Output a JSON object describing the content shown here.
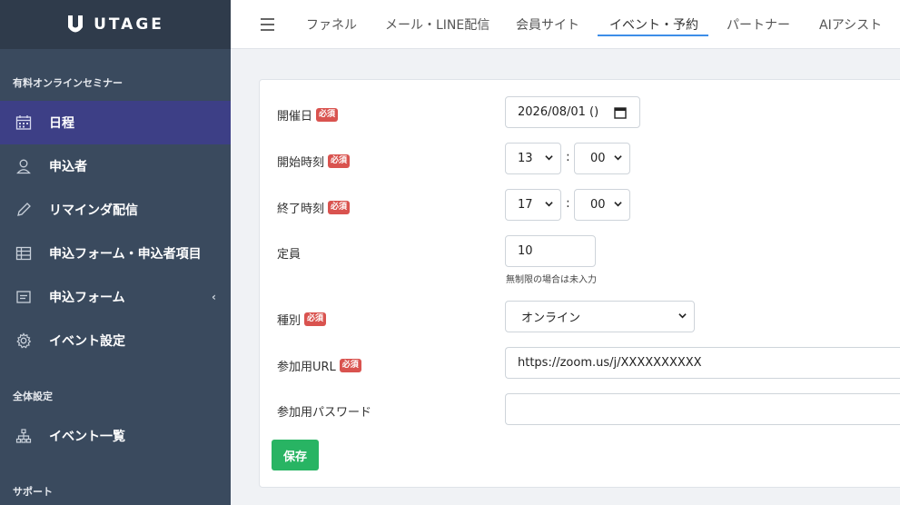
{
  "brand": {
    "name": "UTAGE"
  },
  "sidebar": {
    "section_seminar": "有料オンラインセミナー",
    "items": [
      {
        "label": "日程",
        "icon": "calendar-icon"
      },
      {
        "label": "申込者",
        "icon": "user-icon"
      },
      {
        "label": "リマインダ配信",
        "icon": "pencil-icon"
      },
      {
        "label": "申込フォーム・申込者項目",
        "icon": "table-icon"
      },
      {
        "label": "申込フォーム",
        "icon": "form-icon",
        "chevron": "‹"
      },
      {
        "label": "イベント設定",
        "icon": "gear-icon"
      }
    ],
    "section_global": "全体設定",
    "global_items": [
      {
        "label": "イベント一覧",
        "icon": "sitemap-icon"
      }
    ],
    "section_support": "サポート"
  },
  "topnav": {
    "tabs": [
      "ファネル",
      "メール・LINE配信",
      "会員サイト",
      "イベント・予約",
      "パートナー",
      "AIアシスト"
    ],
    "active_tab": "イベント・予約"
  },
  "form": {
    "required_badge": "必須",
    "date": {
      "label": "開催日",
      "value": "2026/08/01 ()"
    },
    "start_time": {
      "label": "開始時刻",
      "hour": "13",
      "minute": "00"
    },
    "end_time": {
      "label": "終了時刻",
      "hour": "17",
      "minute": "00"
    },
    "capacity": {
      "label": "定員",
      "value": "10",
      "hint": "無制限の場合は未入力"
    },
    "type": {
      "label": "種別",
      "value": "オンライン"
    },
    "url": {
      "label": "参加用URL",
      "value": "https://zoom.us/j/XXXXXXXXXX"
    },
    "password": {
      "label": "参加用パスワード",
      "value": ""
    },
    "save_label": "保存",
    "colon": ":"
  },
  "colors": {
    "sidebar_bg": "#3a4a5e",
    "active_item": "#3d3f86",
    "required": "#d9534f",
    "save": "#28b463",
    "tab_underline": "#3d8ee8"
  }
}
